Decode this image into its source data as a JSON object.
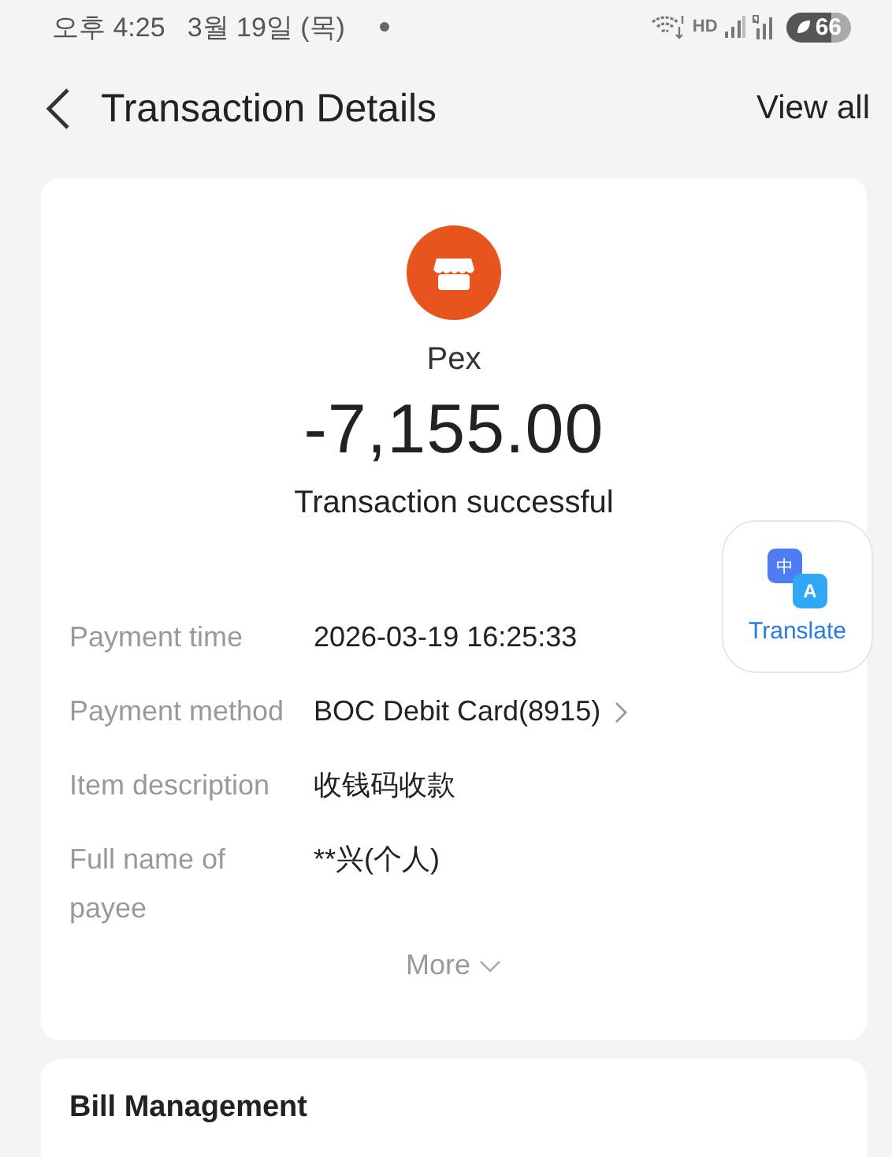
{
  "status_bar": {
    "time": "오후 4:25",
    "date": "3월 19일 (목)",
    "network": "HD",
    "battery": "66"
  },
  "header": {
    "title": "Transaction Details",
    "action": "View all"
  },
  "summary": {
    "merchant": "Pex",
    "amount": "-7,155.00",
    "status": "Transaction successful"
  },
  "details": [
    {
      "label": "Payment time",
      "value": "2026-03-19 16:25:33",
      "kind": "text"
    },
    {
      "label": "Payment method",
      "value": "BOC Debit Card(8915)",
      "kind": "link"
    },
    {
      "label": "Item description",
      "value": "收钱码收款",
      "kind": "text"
    },
    {
      "label": "Full name of payee",
      "value": "**兴(个人)",
      "kind": "text"
    }
  ],
  "more": {
    "label": "More",
    "expanded": false
  },
  "translate": {
    "label": "Translate",
    "icon_source": "中",
    "icon_target": "A"
  },
  "bill_management": {
    "title": "Bill Management"
  }
}
